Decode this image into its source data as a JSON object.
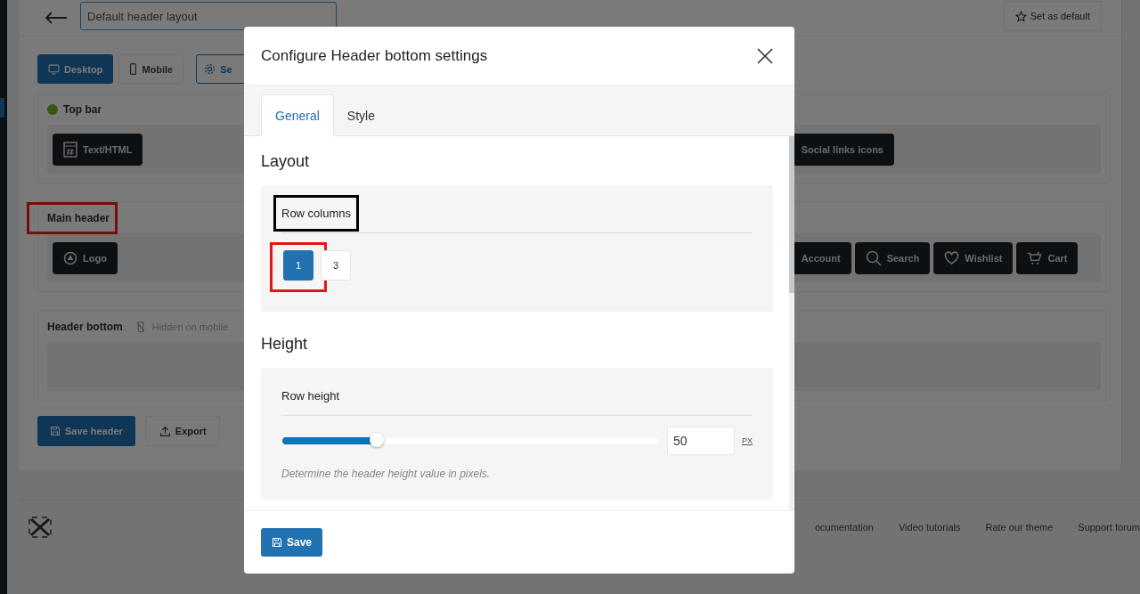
{
  "page": {
    "title_field": {
      "value": "Default header layout"
    },
    "set_default_button": "Set as default",
    "device_tabs": [
      {
        "label": "Desktop",
        "selected": true
      },
      {
        "label": "Mobile",
        "selected": false
      },
      {
        "label": "Se",
        "selected": false
      }
    ],
    "rows": [
      {
        "name": "Top bar",
        "active": true,
        "highlighted": false,
        "left": [
          {
            "label": "Text/HTML",
            "kind": "html"
          }
        ],
        "right": [
          {
            "label": "Social links icons",
            "kind": "social"
          }
        ]
      },
      {
        "name": "Main header",
        "active": false,
        "highlighted": true,
        "left": [
          {
            "label": "Logo",
            "kind": "logo"
          }
        ],
        "right": [
          {
            "label": "Account",
            "kind": "account"
          },
          {
            "label": "Search",
            "kind": "search"
          },
          {
            "label": "Wishlist",
            "kind": "wishlist"
          },
          {
            "label": "Cart",
            "kind": "cart"
          }
        ]
      },
      {
        "name": "Header bottom",
        "active": false,
        "highlighted": false,
        "note": "Hidden on mobile",
        "left": [],
        "right": []
      }
    ],
    "save_button": "Save header",
    "export_button": "Export"
  },
  "footer": {
    "links": [
      "ocumentation",
      "Video tutorials",
      "Rate our theme",
      "Support forum"
    ]
  },
  "modal": {
    "title": "Configure Header bottom settings",
    "tabs": [
      {
        "label": "General",
        "selected": true
      },
      {
        "label": "Style",
        "selected": false
      }
    ],
    "sections": [
      {
        "heading": "Layout",
        "kind": "columns",
        "label": "Row columns",
        "outlined": true,
        "options": [
          {
            "label": "1",
            "selected": true,
            "highlighted": true
          },
          {
            "label": "3",
            "selected": false,
            "highlighted": false
          }
        ]
      },
      {
        "heading": "Height",
        "kind": "slider",
        "label": "Row height",
        "outlined": false,
        "level": 0.25,
        "value": "50",
        "unit": "PX",
        "hint": "Determine the header height value in pixels."
      }
    ],
    "save_button": "Save"
  }
}
